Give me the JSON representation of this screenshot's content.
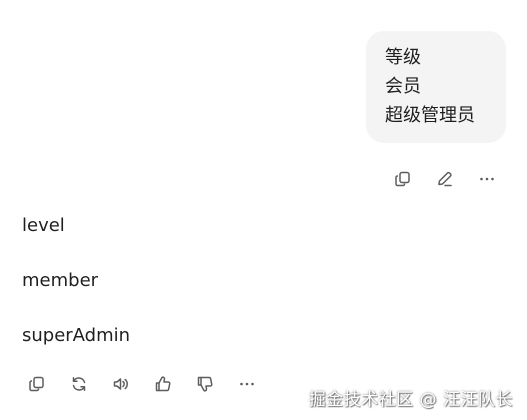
{
  "user_message": {
    "lines": [
      "等级",
      "会员",
      "超级管理员"
    ]
  },
  "user_actions": [
    {
      "name": "copy-icon"
    },
    {
      "name": "edit-icon"
    },
    {
      "name": "more-icon"
    }
  ],
  "assistant_reply": {
    "lines": [
      "level",
      "member",
      "superAdmin"
    ]
  },
  "assistant_actions": [
    {
      "name": "copy-icon"
    },
    {
      "name": "regenerate-icon"
    },
    {
      "name": "read-aloud-icon"
    },
    {
      "name": "thumbs-up-icon"
    },
    {
      "name": "thumbs-down-icon"
    },
    {
      "name": "more-icon"
    }
  ],
  "watermark": "掘金技术社区 @ 汪汪队长",
  "colors": {
    "bubble_bg": "#f4f4f4",
    "text": "#1f1f1f",
    "icon": "#5d5d5d"
  }
}
